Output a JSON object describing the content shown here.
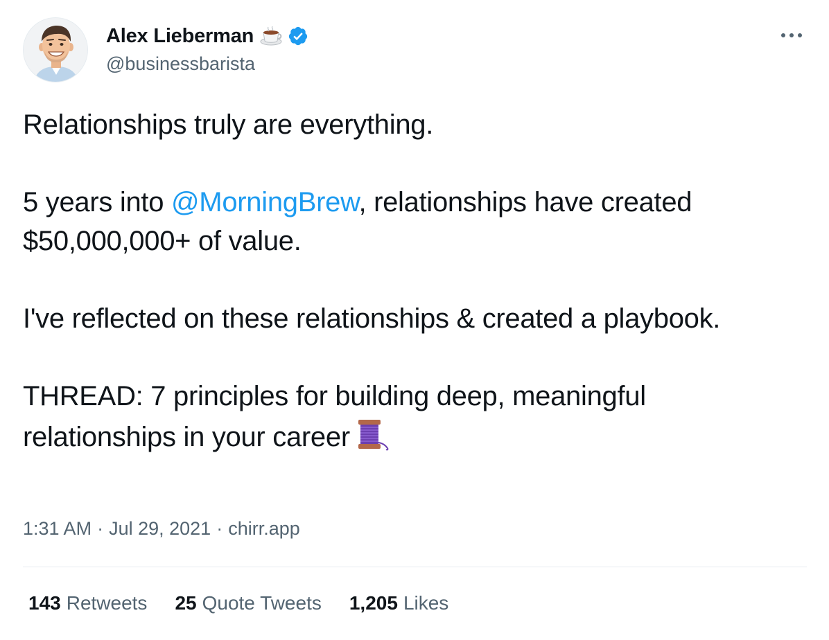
{
  "author": {
    "display_name": "Alex Lieberman",
    "handle": "@businessbarista",
    "name_emoji": "coffee-icon",
    "verified": true
  },
  "tweet": {
    "line1": "Relationships truly are everything.",
    "para2_prefix": "5 years into ",
    "mention": "@MorningBrew",
    "para2_suffix": ", relationships have created $50,000,000+ of value.",
    "para3": "I've reflected on these relationships & created a playbook.",
    "para4": "THREAD: 7 principles for building deep, meaningful relationships in your career",
    "trailing_emoji": "thread-spool-icon"
  },
  "meta": {
    "time": "1:31 AM",
    "date": "Jul 29, 2021",
    "separator": "·",
    "source": "chirr.app"
  },
  "stats": {
    "retweets_count": "143",
    "retweets_label": "Retweets",
    "quote_tweets_count": "25",
    "quote_tweets_label": "Quote Tweets",
    "likes_count": "1,205",
    "likes_label": "Likes"
  },
  "colors": {
    "link": "#1d9bf0",
    "secondary_text": "#536471",
    "primary_text": "#0f1419",
    "divider": "#e6ecf0",
    "verified": "#1d9bf0"
  }
}
